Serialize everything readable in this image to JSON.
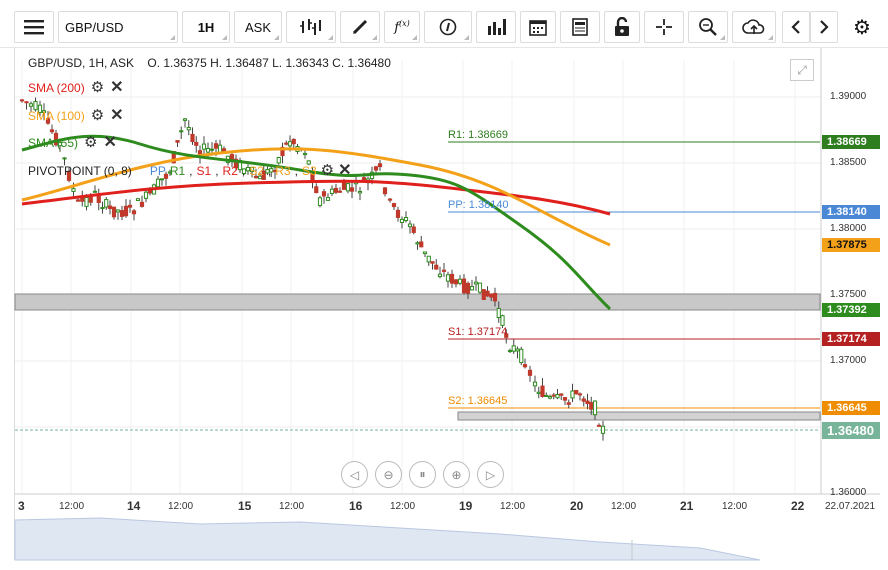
{
  "toolbar": {
    "symbol": "GBP/USD",
    "timeframe": "1H",
    "price_side": "ASK",
    "buttons": [
      "menu-icon",
      "bar-style-icon",
      "draw-icon",
      "function-icon",
      "info-icon",
      "volume-icon",
      "calendar-icon",
      "news-icon",
      "lock-icon",
      "crosshair-icon",
      "zoom-icon",
      "cloud-upload-icon",
      "prev-icon",
      "next-icon",
      "settings-icon"
    ]
  },
  "header": {
    "ohlc_text": "GBP/USD, 1H, ASK    O. 1.36375 H. 1.36487 L. 1.36343 C. 1.36480"
  },
  "indicators": [
    {
      "label": "SMA (200)",
      "color": "#e0201c"
    },
    {
      "label": "SMA (100)",
      "color": "#f4a11a"
    },
    {
      "label": "SMA (55)",
      "color": "#2e8b1e"
    }
  ],
  "pivot": {
    "label": "PIVOTPOINT (0, 8)",
    "tags": [
      {
        "text": "PP",
        "color": "#4a88d6"
      },
      {
        "text": "R1",
        "color": "#2e8b1e"
      },
      {
        "text": "S1",
        "color": "#e0201c"
      },
      {
        "text": "R2",
        "color": "#e0201c"
      },
      {
        "text": "S2",
        "color": "#f4a11a"
      },
      {
        "text": "R3",
        "color": "#f4a11a"
      },
      {
        "text": "S3",
        "color": "#f4a11a"
      }
    ]
  },
  "levels": {
    "r1": {
      "label": "R1: 1.38669",
      "tag": "1.38669",
      "color": "#2e7d1e",
      "value": 1.38669
    },
    "pp": {
      "label": "PP: 1.38140",
      "tag": "1.38140",
      "color": "#4a88d6",
      "value": 1.3814
    },
    "s1": {
      "label": "S1: 1.37174",
      "tag": "1.37174",
      "color": "#b52020",
      "value": 1.37174
    },
    "s2": {
      "label": "S2: 1.36645",
      "tag": "1.36645",
      "color": "#f08c00",
      "value": 1.36645
    }
  },
  "sma_tags": {
    "sma100": {
      "text": "1.37875",
      "color": "#f4a11a"
    },
    "sma55": {
      "text": "1.37392",
      "color": "#2e8b1e"
    },
    "last": {
      "text": "1.36480",
      "color": "#78b49a"
    }
  },
  "y_axis": [
    "1.39000",
    "1.38500",
    "1.38000",
    "1.37500",
    "1.37000",
    "1.36000"
  ],
  "x_axis": [
    {
      "t": "3",
      "day": true
    },
    {
      "t": "12:00",
      "day": false
    },
    {
      "t": "14",
      "day": true
    },
    {
      "t": "12:00",
      "day": false
    },
    {
      "t": "15",
      "day": true
    },
    {
      "t": "12:00",
      "day": false
    },
    {
      "t": "16",
      "day": true
    },
    {
      "t": "12:00",
      "day": false
    },
    {
      "t": "19",
      "day": true
    },
    {
      "t": "12:00",
      "day": false
    },
    {
      "t": "20",
      "day": true
    },
    {
      "t": "12:00",
      "day": false
    },
    {
      "t": "21",
      "day": true
    },
    {
      "t": "12:00",
      "day": false
    },
    {
      "t": "22",
      "day": true
    },
    {
      "t": "22.07.2021",
      "day": false
    }
  ],
  "nav_buttons": [
    "scroll-left-icon",
    "zoom-out-icon",
    "reset-icon",
    "zoom-in-icon",
    "scroll-right-icon"
  ]
}
